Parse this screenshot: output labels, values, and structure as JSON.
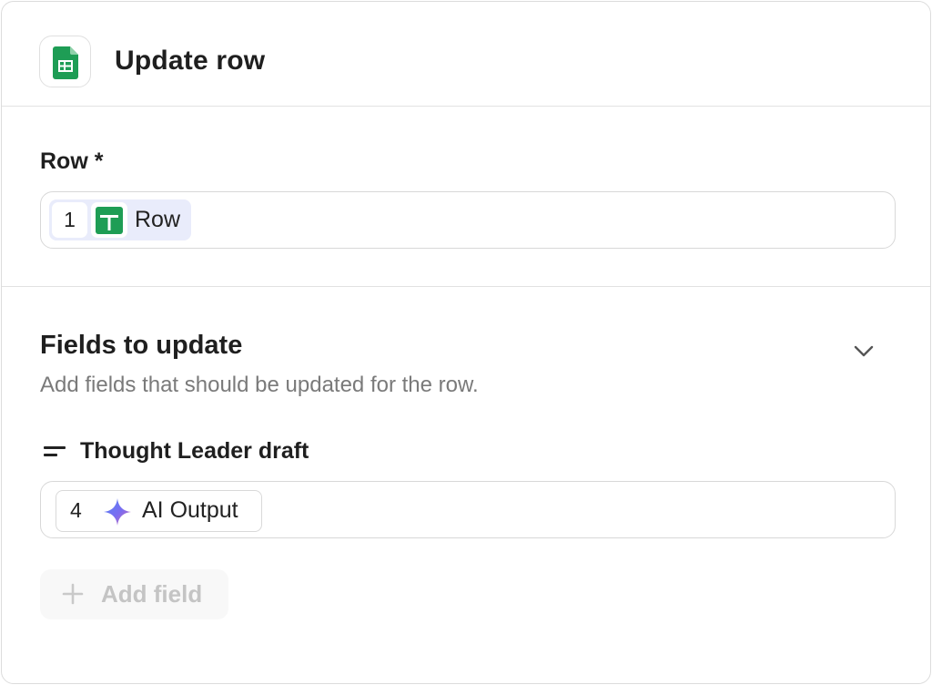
{
  "header": {
    "app_icon": "google-sheets-icon",
    "title": "Update row"
  },
  "row_field": {
    "label": "Row *",
    "token": {
      "step_number": "1",
      "icon": "google-sheets-icon",
      "label": "Row"
    }
  },
  "fields_section": {
    "title": "Fields to update",
    "description": "Add fields that should be updated for the row.",
    "collapse_icon": "chevron-down-icon",
    "fields": [
      {
        "icon": "text-field-icon",
        "label": "Thought Leader draft",
        "token": {
          "step_number": "4",
          "icon": "ai-sparkle-icon",
          "label": "AI Output"
        }
      }
    ],
    "add_field_label": "Add field"
  },
  "colors": {
    "sheets_green": "#1e9d55",
    "token_bg": "#e9ecfb",
    "muted_text": "#7a7a7a",
    "disabled_text": "#c4c4c4"
  }
}
